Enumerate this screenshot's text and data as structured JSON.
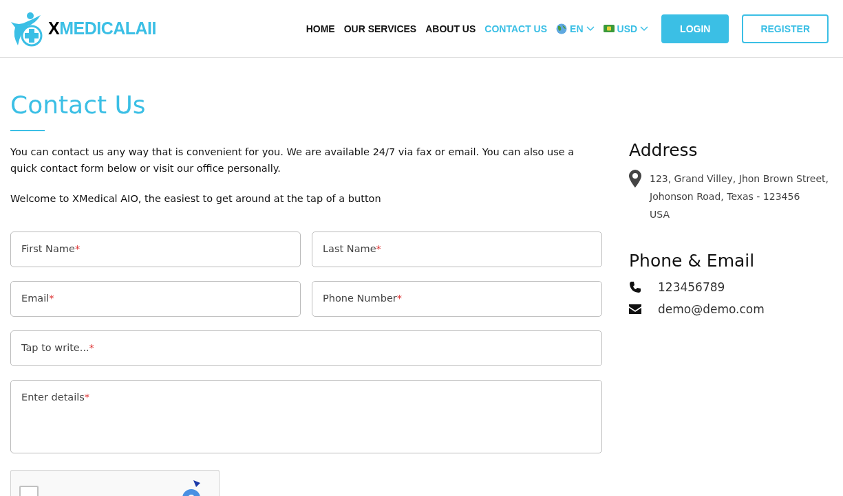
{
  "header": {
    "logo": {
      "first": "X",
      "rest": "MEDICALAII"
    },
    "nav": [
      {
        "label": "HOME",
        "selected": false
      },
      {
        "label": "OUR SERVICES",
        "selected": false
      },
      {
        "label": "ABOUT US",
        "selected": false
      },
      {
        "label": "CONTACT US",
        "selected": true
      }
    ],
    "selectors": [
      {
        "kind": "language",
        "label": "EN"
      },
      {
        "kind": "currency",
        "label": "USD"
      }
    ],
    "buttons": [
      {
        "kind": "filled",
        "label": "LOGIN"
      },
      {
        "kind": "outline",
        "label": "REGISTER"
      }
    ]
  },
  "title": "Contact Us",
  "intro": [
    "You can contact us any way that is convenient for you. We are available 24/7 via fax or email. You can also use a quick contact form below or visit our office personally.",
    "Welcome to XMedical AIO, the easiest to get around at the tap of a button"
  ],
  "form": {
    "rows": [
      [
        {
          "kind": "input",
          "label": "First Name",
          "mark": "*"
        },
        {
          "kind": "input",
          "label": "Last Name",
          "mark": "*"
        }
      ],
      [
        {
          "kind": "input",
          "label": "Email",
          "mark": "*"
        },
        {
          "kind": "input",
          "label": "Phone Number",
          "mark": "*"
        }
      ],
      [
        {
          "kind": "input",
          "label": "Tap to write...",
          "mark": "*"
        }
      ],
      [
        {
          "kind": "textarea",
          "label": "Enter details",
          "mark": "*"
        }
      ]
    ],
    "captcha": {
      "checked": false
    }
  },
  "sidebar": {
    "address_title": "Address",
    "address_lines": [
      "123, Grand Villey, Jhon Brown Street,",
      "Johonson Road, Texas - 123456",
      "USA"
    ],
    "contact_title": "Phone & Email",
    "contacts": [
      {
        "kind": "phone",
        "text": "123456789"
      },
      {
        "kind": "email",
        "text": "demo@demo.com"
      }
    ]
  }
}
